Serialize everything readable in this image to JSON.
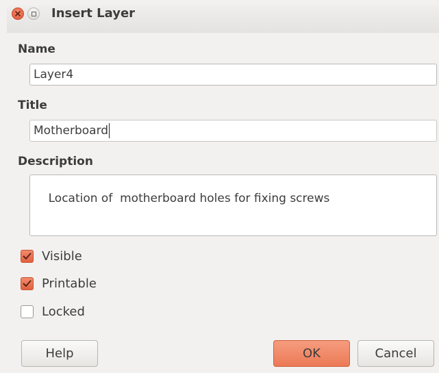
{
  "window": {
    "title": "Insert Layer"
  },
  "form": {
    "name_label": "Name",
    "name_value": "Layer4",
    "title_label": "Title",
    "title_value": "Motherboard",
    "description_label": "Description",
    "description_value": "Location of  motherboard holes for fixing screws"
  },
  "options": [
    {
      "label": "Visible",
      "checked": true
    },
    {
      "label": "Printable",
      "checked": true
    },
    {
      "label": "Locked",
      "checked": false
    }
  ],
  "buttons": {
    "help": "Help",
    "ok": "OK",
    "cancel": "Cancel"
  },
  "colors": {
    "accent": "#ec7a56",
    "close_button": "#e0553a"
  },
  "icons": {
    "close": "close-icon",
    "maximize": "maximize-icon",
    "check": "checkmark-icon"
  }
}
